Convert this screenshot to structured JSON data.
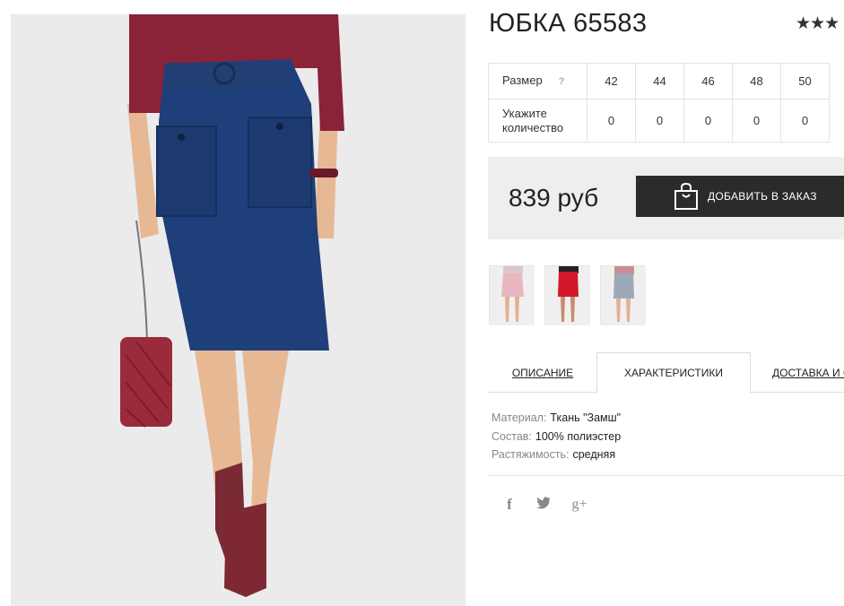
{
  "product": {
    "title": "ЮБКА 65583",
    "stars": "★★★",
    "image_alt": "product-photo"
  },
  "sizes": {
    "row_label": "Размер",
    "help": "?",
    "values": [
      "42",
      "44",
      "46",
      "48",
      "50"
    ],
    "qty_label": "Укажите количество",
    "quantities": [
      "0",
      "0",
      "0",
      "0",
      "0"
    ]
  },
  "price": {
    "amount": "839 руб",
    "button_label": "ДОБАВИТЬ В ЗАКАЗ"
  },
  "thumbnails": [
    {
      "name": "pink-skirt"
    },
    {
      "name": "red-skirt"
    },
    {
      "name": "grey-skirt"
    }
  ],
  "tabs": {
    "description": "ОПИСАНИЕ",
    "specs": "ХАРАКТЕРИСТИКИ",
    "delivery": "ДОСТАВКА И ОПЛАТА"
  },
  "specs": [
    {
      "key": "Материал:",
      "value": "Ткань \"Замш\""
    },
    {
      "key": "Состав:",
      "value": "100% полиэстер"
    },
    {
      "key": "Растяжимость:",
      "value": "средняя"
    }
  ],
  "social": {
    "facebook": "f",
    "twitter": "t",
    "gplus": "g+"
  },
  "colors": {
    "accent_button": "#2b2b2b",
    "skirt": "#1f3f7a",
    "sweater": "#8a2238"
  }
}
